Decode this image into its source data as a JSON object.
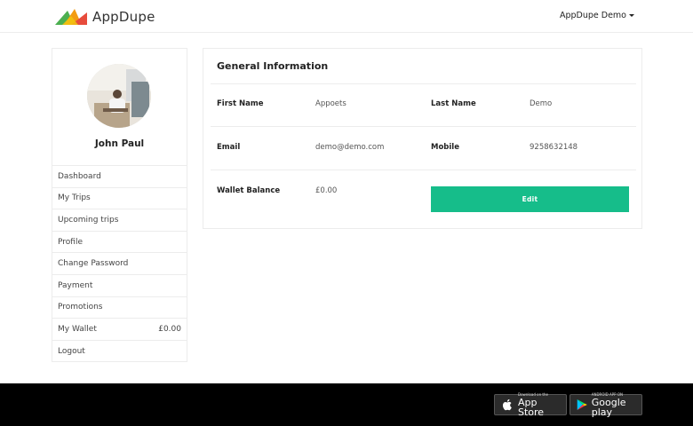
{
  "header": {
    "brand": "AppDupe",
    "user_menu": "AppDupe Demo"
  },
  "sidebar": {
    "user_name": "John Paul",
    "items": [
      {
        "label": "Dashboard",
        "value": ""
      },
      {
        "label": "My Trips",
        "value": ""
      },
      {
        "label": "Upcoming trips",
        "value": ""
      },
      {
        "label": "Profile",
        "value": ""
      },
      {
        "label": "Change Password",
        "value": ""
      },
      {
        "label": "Payment",
        "value": ""
      },
      {
        "label": "Promotions",
        "value": ""
      },
      {
        "label": "My Wallet",
        "value": "£0.00"
      },
      {
        "label": "Logout",
        "value": ""
      }
    ]
  },
  "general_info": {
    "title": "General Information",
    "first_name_label": "First Name",
    "first_name": "Appoets",
    "last_name_label": "Last Name",
    "last_name": "Demo",
    "email_label": "Email",
    "email": "demo@demo.com",
    "mobile_label": "Mobile",
    "mobile": "9258632148",
    "wallet_label": "Wallet Balance",
    "wallet": "£0.00",
    "edit_label": "Edit"
  },
  "footer": {
    "app_store_small": "Download on the",
    "app_store_big": "App Store",
    "google_small": "ANDROID APP ON",
    "google_big": "Google play"
  },
  "colors": {
    "accent": "#16bd8a",
    "footer_bg": "#000000"
  }
}
